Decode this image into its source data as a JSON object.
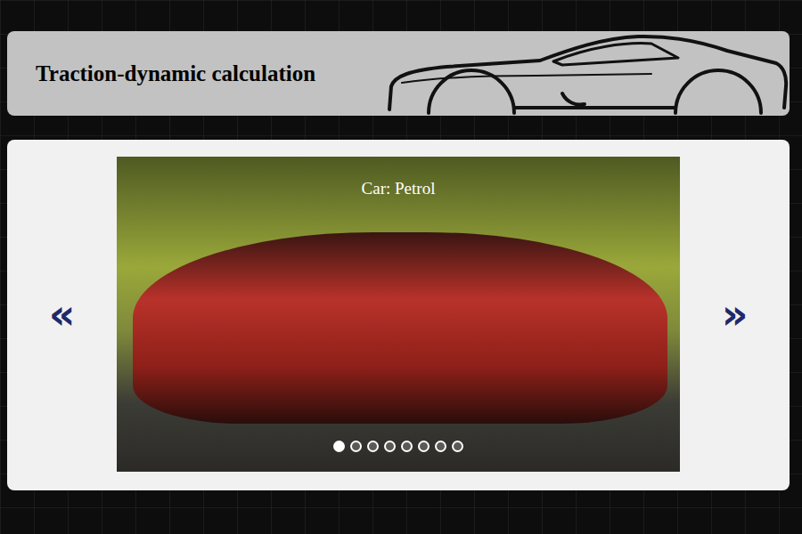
{
  "header": {
    "title": "Traction-dynamic calculation"
  },
  "carousel": {
    "caption": "Car: Petrol",
    "prev": "«",
    "next": "»",
    "slides": [
      {
        "selected": true
      },
      {
        "selected": false
      },
      {
        "selected": false
      },
      {
        "selected": false
      },
      {
        "selected": false
      },
      {
        "selected": false
      },
      {
        "selected": false
      },
      {
        "selected": false
      }
    ]
  }
}
